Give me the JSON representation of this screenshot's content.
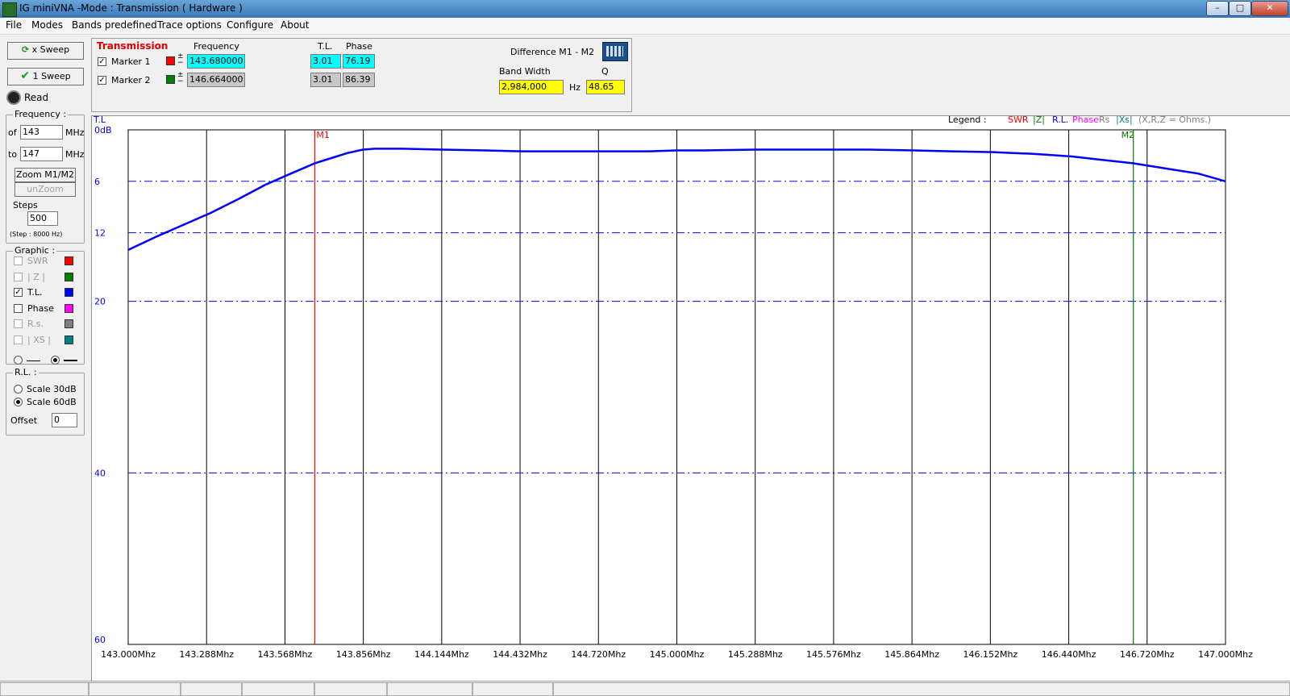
{
  "window": {
    "title": "IG miniVNA -Mode : Transmission ( Hardware )",
    "min_label": "–",
    "max_label": "□",
    "close_label": "✕"
  },
  "menu": [
    "File",
    "Modes",
    "Bands predefined",
    "Trace options",
    "Configure",
    "About"
  ],
  "left": {
    "xsweep_label": "x Sweep",
    "sweep1_label": "1 Sweep",
    "read_label": "Read",
    "frequency_title": "Frequency :",
    "of_label": "of",
    "of_value": "143",
    "to_label": "to",
    "to_value": "147",
    "unit_mhz": "MHz",
    "zoom_label": "Zoom M1/M2",
    "unzoom_label": "unZoom",
    "steps_label": "Steps",
    "steps_value": "500",
    "step_note": "(Step : 8000 Hz)",
    "graphic_title": "Graphic :",
    "traces": [
      {
        "label": "SWR",
        "checked": false,
        "enabled": false,
        "color": "#ff0000"
      },
      {
        "label": "| Z |",
        "checked": false,
        "enabled": false,
        "color": "#008000"
      },
      {
        "label": "T.L.",
        "checked": true,
        "enabled": true,
        "color": "#0000ff"
      },
      {
        "label": "Phase",
        "checked": false,
        "enabled": true,
        "color": "#ff00ff"
      },
      {
        "label": "R.s.",
        "checked": false,
        "enabled": false,
        "color": "#808080"
      },
      {
        "label": "| XS |",
        "checked": false,
        "enabled": false,
        "color": "#008080"
      }
    ],
    "rl_title": "R.L. :",
    "scale30_label": "Scale 30dB",
    "scale60_label": "Scale 60dB",
    "offset_label": "Offset",
    "offset_value": "0"
  },
  "markers": {
    "section_label": "Transmission",
    "freq_header": "Frequency",
    "tl_header": "T.L.",
    "phase_header": "Phase",
    "m1": {
      "label": "Marker 1",
      "freq": "143.680000",
      "tl": "3.01",
      "phase": "76.19",
      "color": "#ff0000"
    },
    "m2": {
      "label": "Marker 2",
      "freq": "146.664000",
      "tl": "3.01",
      "phase": "86.39",
      "color": "#008000"
    },
    "diff_label": "Difference M1 - M2",
    "bw_label": "Band Width",
    "bw_value": "2,984,000",
    "hz_label": "Hz",
    "q_label": "Q",
    "q_value": "48.65"
  },
  "chart": {
    "axis_name": "T.L",
    "legend_label": "Legend :",
    "legend_items": [
      {
        "text": "SWR",
        "color": "#ff0000"
      },
      {
        "text": "|Z|",
        "color": "#008000"
      },
      {
        "text": "R.L.",
        "color": "#0000ff"
      },
      {
        "text": "Phase",
        "color": "#ff00ff"
      },
      {
        "text": "Rs",
        "color": "#808080"
      },
      {
        "text": "|Xs|",
        "color": "#008080"
      },
      {
        "text": "(X,R,Z = Ohms.)",
        "color": "#808080"
      }
    ],
    "m1_label": "M1",
    "m2_label": "M2"
  },
  "chart_data": {
    "type": "line",
    "title": "",
    "xlabel": "",
    "ylabel": "T.L",
    "xlim": [
      143.0,
      147.0
    ],
    "ylim": [
      0,
      60
    ],
    "y_inverted": true,
    "x_tick_labels": [
      "143.000Mhz",
      "143.288Mhz",
      "143.568Mhz",
      "143.856Mhz",
      "144.144Mhz",
      "144.432Mhz",
      "144.720Mhz",
      "145.000Mhz",
      "145.288Mhz",
      "145.576Mhz",
      "145.864Mhz",
      "146.152Mhz",
      "146.440Mhz",
      "146.720Mhz",
      "147.000Mhz"
    ],
    "y_ticks": [
      0,
      6,
      12,
      20,
      40,
      60
    ],
    "y_tick_labels": [
      "0dB",
      "6",
      "12",
      "20",
      "40",
      "60"
    ],
    "markers": [
      {
        "name": "M1",
        "x": 143.68,
        "color": "#ff0000"
      },
      {
        "name": "M2",
        "x": 146.664,
        "color": "#008000"
      }
    ],
    "series": [
      {
        "color": "#0000ff",
        "x": [
          143.0,
          143.1,
          143.2,
          143.3,
          143.4,
          143.5,
          143.6,
          143.68,
          143.75,
          143.8,
          143.856,
          143.9,
          144.0,
          144.144,
          144.3,
          144.432,
          144.6,
          144.72,
          144.9,
          145.0,
          145.1,
          145.288,
          145.4,
          145.576,
          145.7,
          145.864,
          146.0,
          146.152,
          146.3,
          146.44,
          146.55,
          146.664,
          146.8,
          146.9,
          147.0
        ],
        "values": [
          14.0,
          12.5,
          11.1,
          9.7,
          8.1,
          6.4,
          5.0,
          3.9,
          3.2,
          2.7,
          2.3,
          2.2,
          2.2,
          2.3,
          2.4,
          2.5,
          2.5,
          2.5,
          2.5,
          2.4,
          2.4,
          2.3,
          2.3,
          2.3,
          2.3,
          2.4,
          2.5,
          2.6,
          2.8,
          3.1,
          3.5,
          3.9,
          4.6,
          5.1,
          6.0
        ]
      }
    ]
  }
}
